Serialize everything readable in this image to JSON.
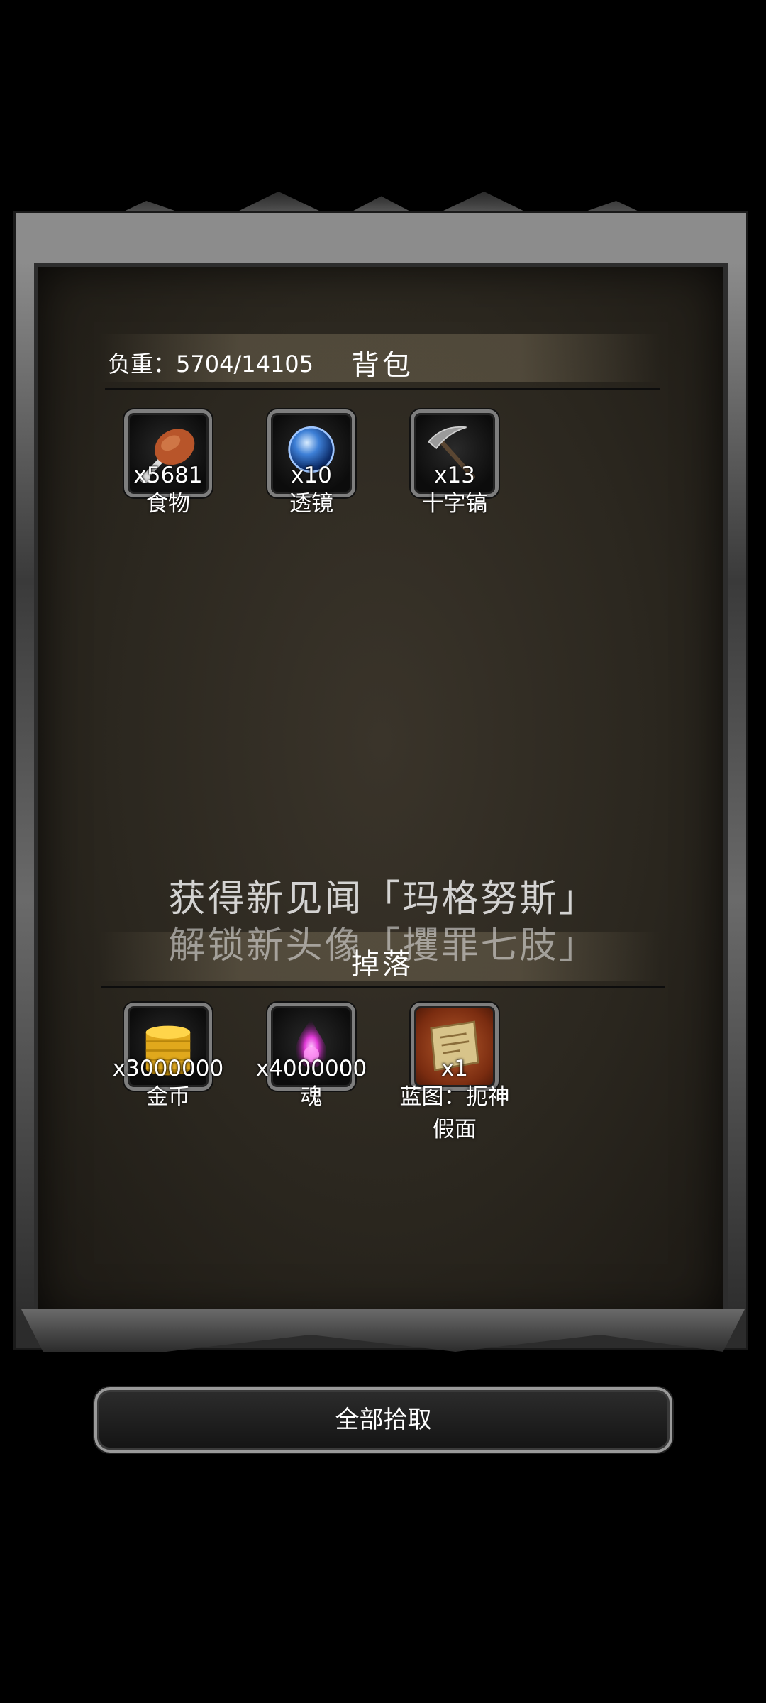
{
  "backpack": {
    "weight_label": "负重：5704/14105",
    "title": "背包",
    "items": [
      {
        "count": "x5681",
        "name": "食物",
        "icon": "food-drumstick-icon"
      },
      {
        "count": "x10",
        "name": "透镜",
        "icon": "lens-orb-icon"
      },
      {
        "count": "x13",
        "name": "十字镐",
        "icon": "pickaxe-icon"
      }
    ]
  },
  "notifications": [
    "获得新见闻「玛格努斯」",
    "解锁新头像「攫罪七肢」"
  ],
  "drops": {
    "title": "掉落",
    "items": [
      {
        "count": "x3000000",
        "name": "金币",
        "icon": "gold-coins-icon"
      },
      {
        "count": "x4000000",
        "name": "魂",
        "icon": "soul-flame-icon"
      },
      {
        "count": "x1",
        "name": "蓝图：扼神",
        "name_line2": "假面",
        "icon": "blueprint-scroll-icon"
      }
    ]
  },
  "actions": {
    "pickup_all": "全部拾取"
  },
  "colors": {
    "panel_bg": "#2b271f",
    "frame": "#5b5b5b",
    "rare_slot": "#b55a2c"
  }
}
